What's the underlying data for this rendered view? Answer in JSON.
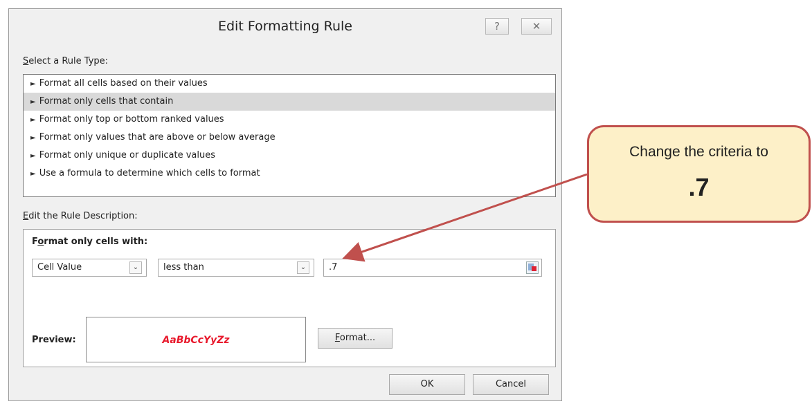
{
  "dialog": {
    "title": "Edit Formatting Rule",
    "help_glyph": "?",
    "close_glyph": "✕"
  },
  "rule_type": {
    "label_accel": "S",
    "label_rest": "elect a Rule Type:",
    "arrow_glyph": "►",
    "items": [
      "Format all cells based on their values",
      "Format only cells that contain",
      "Format only top or bottom ranked values",
      "Format only values that are above or below average",
      "Format only unique or duplicate values",
      "Use a formula to determine which cells to format"
    ],
    "selected_index": 1
  },
  "description": {
    "label_accel": "E",
    "label_rest": "dit the Rule Description:",
    "heading_pre": "F",
    "heading_accel": "o",
    "heading_rest": "rmat only cells with:",
    "condition_type": "Cell Value",
    "operator": "less than",
    "value": ".7",
    "dropdown_glyph": "⌄",
    "preview_label": "Preview:",
    "preview_text": "AaBbCcYyZz",
    "preview_color": "#e8192c",
    "format_accel": "F",
    "format_rest": "ormat..."
  },
  "buttons": {
    "ok": "OK",
    "cancel": "Cancel"
  },
  "callout": {
    "line1": "Change the criteria to",
    "line2": ".7",
    "border_color": "#c0504d",
    "fill_color": "#fdf0c8"
  }
}
